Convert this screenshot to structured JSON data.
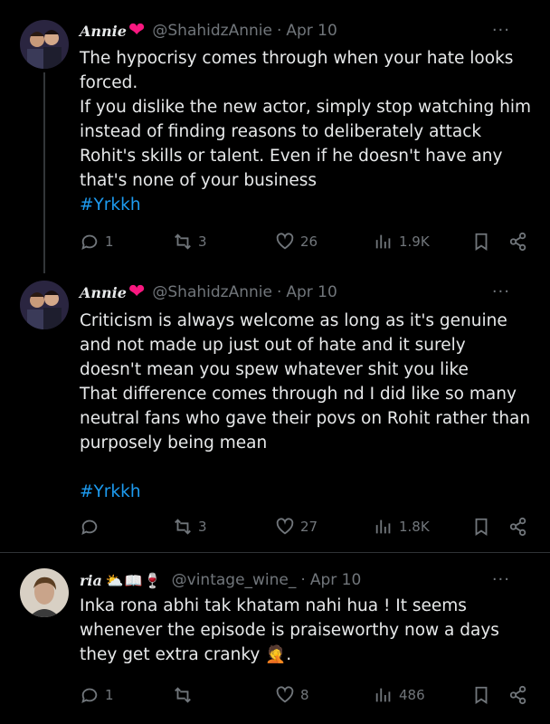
{
  "tweets": [
    {
      "name": "Annie",
      "handle": "@ShahidzAnnie",
      "date": "Apr 10",
      "lines": [
        "The hypocrisy comes through when your hate looks forced.",
        "If you dislike the new actor, simply stop watching him instead of finding reasons to deliberately attack Rohit's skills or talent. Even if he doesn't have any that's none of your business"
      ],
      "hashtag": "#Yrkkh",
      "replies": "1",
      "reposts": "3",
      "likes": "26",
      "views": "1.9K"
    },
    {
      "name": "Annie",
      "handle": "@ShahidzAnnie",
      "date": "Apr 10",
      "lines": [
        "Criticism is always welcome as long as it's genuine and not made up just out of hate and it surely doesn't mean you spew whatever shit you like",
        "That difference comes through nd I did like so many neutral fans who gave their povs on Rohit rather than purposely being mean"
      ],
      "hashtag": "#Yrkkh",
      "replies": "",
      "reposts": "3",
      "likes": "27",
      "views": "1.8K"
    },
    {
      "name": "ria",
      "name_emojis": "⛅📖🍷",
      "handle": "@vintage_wine_",
      "date": "Apr 10",
      "lines": [
        "Inka rona abhi tak khatam nahi hua ! It seems whenever the episode is praiseworthy now a days they get extra cranky 🤦."
      ],
      "replies": "1",
      "reposts": "",
      "likes": "8",
      "views": "486"
    }
  ],
  "separator": "·",
  "more_glyph": "···",
  "icons": {
    "reply": "reply-icon",
    "repost": "repost-icon",
    "like": "heart-icon",
    "views": "views-icon",
    "bookmark": "bookmark-icon",
    "share": "share-icon"
  },
  "colors": {
    "background": "#000000",
    "text": "#e7e9ea",
    "muted": "#71767b",
    "link": "#1d9bf0",
    "heart": "#f91880"
  }
}
